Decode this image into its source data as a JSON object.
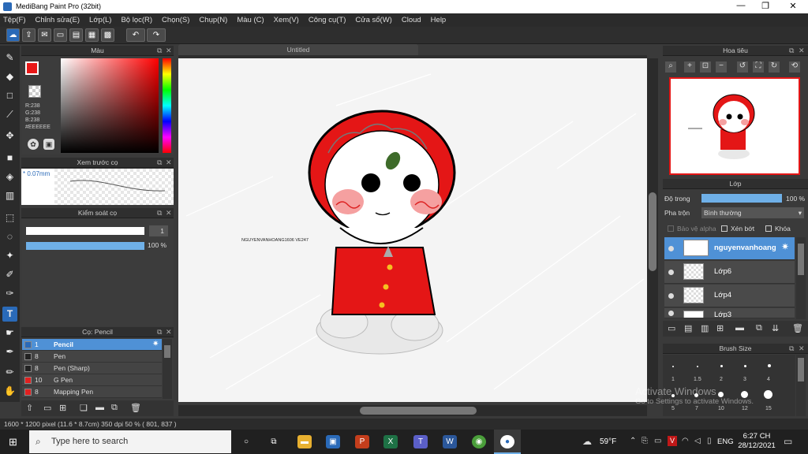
{
  "window": {
    "title": "MediBang Paint Pro (32bit)",
    "min": "—",
    "max": "❐",
    "close": "✕"
  },
  "menu": [
    "Tệp(F)",
    "Chỉnh sửa(E)",
    "Lớp(L)",
    "Bộ lọc(R)",
    "Chọn(S)",
    "Chụp(N)",
    "Màu (C)",
    "Xem(V)",
    "Công cụ(T)",
    "Cửa sổ(W)",
    "Cloud",
    "Help"
  ],
  "color_panel": {
    "title": "Màu",
    "r": "R:238",
    "g": "G:238",
    "b": "B:238",
    "hex": "#EEEEEE",
    "fg": "#e81818"
  },
  "preview_panel": {
    "title": "Xem trước cọ",
    "size": "* 0.07mm"
  },
  "brush_control": {
    "title": "Kiểm soát cọ",
    "size_value": "1",
    "opacity_value": "100 %"
  },
  "brush_panel": {
    "title": "Cọ: Pencil",
    "items": [
      {
        "size": "1",
        "name": "Pencil",
        "color": "#2a6ab8"
      },
      {
        "size": "8",
        "name": "Pen",
        "color": "#222222"
      },
      {
        "size": "8",
        "name": "Pen (Sharp)",
        "color": "#222222"
      },
      {
        "size": "10",
        "name": "G Pen",
        "color": "#e02020"
      },
      {
        "size": "8",
        "name": "Mapping Pen",
        "color": "#e02020"
      }
    ]
  },
  "canvas": {
    "tab": "Untitled",
    "watermark": "NGUYENVANHOANG1606\nVE247"
  },
  "navigator": {
    "title": "Hoa tiêu"
  },
  "layer_panel": {
    "title": "Lớp",
    "opacity_label": "Độ trong",
    "opacity_value": "100 %",
    "blend_label": "Pha trộn",
    "blend_value": "Bình thường",
    "protect_alpha": "Bảo vệ alpha",
    "clipping": "Xén bớt",
    "lock": "Khóa",
    "layers": [
      "nguyenvanhoang",
      "Lớp6",
      "Lớp4",
      "Lớp3"
    ]
  },
  "brush_size": {
    "title": "Brush Size",
    "labels": [
      "1",
      "1.5",
      "2",
      "3",
      "4",
      "5",
      "7",
      "10",
      "12",
      "15"
    ]
  },
  "activation": {
    "line1": "Activate Windows",
    "line2": "Go to Settings to activate Windows."
  },
  "status": {
    "text": "1600 * 1200 pixel  (11.6 * 8.7cm)  350 dpi  50 %  ( 801, 837 )"
  },
  "taskbar": {
    "search_placeholder": "Type here to search",
    "weather": "59°F",
    "lang": "ENG",
    "time": "6:27 CH",
    "date": "28/12/2021"
  }
}
